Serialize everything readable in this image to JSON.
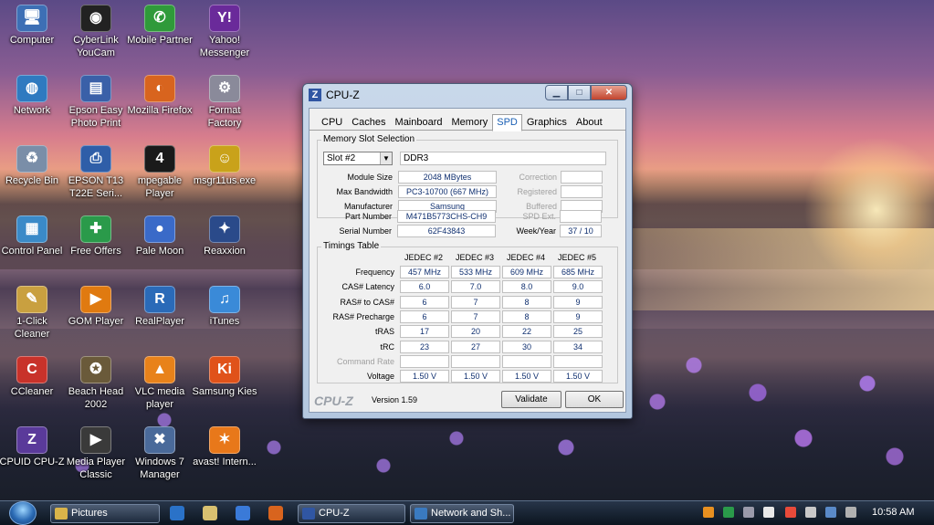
{
  "desktop": {
    "icons": [
      {
        "label": "Computer",
        "glyph": "🖥",
        "color": "#3d6fb5"
      },
      {
        "label": "CyberLink YouCam",
        "glyph": "◉",
        "color": "#222222"
      },
      {
        "label": "Mobile Partner",
        "glyph": "✆",
        "color": "#2f9a3a"
      },
      {
        "label": "Yahoo! Messenger",
        "glyph": "Y!",
        "color": "#6a2a9a"
      },
      {
        "label": "Network",
        "glyph": "◍",
        "color": "#2f7ac0"
      },
      {
        "label": "Epson Easy Photo Print",
        "glyph": "▤",
        "color": "#3a60a8"
      },
      {
        "label": "Mozilla Firefox",
        "glyph": "◐",
        "color": "#d8641e"
      },
      {
        "label": "Format Factory",
        "glyph": "⚙",
        "color": "#8a8a9a"
      },
      {
        "label": "Recycle Bin",
        "glyph": "♻",
        "color": "#7a8ea8"
      },
      {
        "label": "EPSON T13 T22E Seri...",
        "glyph": "⎙",
        "color": "#2f5ea8"
      },
      {
        "label": "mpegable Player",
        "glyph": "4",
        "color": "#1a1a1a"
      },
      {
        "label": "msgr11us.exe",
        "glyph": "☺",
        "color": "#c9a21a"
      },
      {
        "label": "Control Panel",
        "glyph": "▦",
        "color": "#3a8ac8"
      },
      {
        "label": "Free Offers",
        "glyph": "✚",
        "color": "#2a9a4a"
      },
      {
        "label": "Pale Moon",
        "glyph": "●",
        "color": "#3a6ac8"
      },
      {
        "label": "Reaxxion",
        "glyph": "✦",
        "color": "#2a4a8a"
      },
      {
        "label": "1-Click Cleaner",
        "glyph": "✎",
        "color": "#c9a040"
      },
      {
        "label": "GOM Player",
        "glyph": "▶",
        "color": "#e07a10"
      },
      {
        "label": "RealPlayer",
        "glyph": "R",
        "color": "#2a6ab8"
      },
      {
        "label": "iTunes",
        "glyph": "♫",
        "color": "#3a8ad8"
      },
      {
        "label": "CCleaner",
        "glyph": "C",
        "color": "#c8322a"
      },
      {
        "label": "Beach Head 2002",
        "glyph": "✪",
        "color": "#6a5a3a"
      },
      {
        "label": "VLC media player",
        "glyph": "▲",
        "color": "#e8821a"
      },
      {
        "label": "Samsung Kies",
        "glyph": "Ki",
        "color": "#e0521a"
      },
      {
        "label": "CPUID CPU-Z",
        "glyph": "Z",
        "color": "#5a3a9a"
      },
      {
        "label": "Media Player Classic",
        "glyph": "▶",
        "color": "#3a3a3a"
      },
      {
        "label": "Windows 7 Manager",
        "glyph": "✖",
        "color": "#4a6a9a"
      },
      {
        "label": "avast! Intern...",
        "glyph": "✶",
        "color": "#e8781a"
      }
    ]
  },
  "window": {
    "title": "CPU-Z",
    "tabs": [
      "CPU",
      "Caches",
      "Mainboard",
      "Memory",
      "SPD",
      "Graphics",
      "About"
    ],
    "active_tab": "SPD",
    "slot_group_label": "Memory Slot Selection",
    "slot_selected": "Slot #2",
    "memory_type": "DDR3",
    "module": {
      "module_size_label": "Module Size",
      "module_size": "2048 MBytes",
      "max_bandwidth_label": "Max Bandwidth",
      "max_bandwidth": "PC3-10700 (667 MHz)",
      "manufacturer_label": "Manufacturer",
      "manufacturer": "Samsung",
      "part_number_label": "Part Number",
      "part_number": "M471B5773CHS-CH9",
      "serial_number_label": "Serial Number",
      "serial_number": "62F43843",
      "correction_label": "Correction",
      "registered_label": "Registered",
      "buffered_label": "Buffered",
      "spd_ext_label": "SPD Ext.",
      "week_year_label": "Week/Year",
      "week_year": "37 / 10"
    },
    "timings_group_label": "Timings Table",
    "timing_columns": [
      "JEDEC #2",
      "JEDEC #3",
      "JEDEC #4",
      "JEDEC #5"
    ],
    "timing_rows": [
      {
        "label": "Frequency",
        "values": [
          "457 MHz",
          "533 MHz",
          "609 MHz",
          "685 MHz"
        ]
      },
      {
        "label": "CAS# Latency",
        "values": [
          "6.0",
          "7.0",
          "8.0",
          "9.0"
        ]
      },
      {
        "label": "RAS# to CAS#",
        "values": [
          "6",
          "7",
          "8",
          "9"
        ]
      },
      {
        "label": "RAS# Precharge",
        "values": [
          "6",
          "7",
          "8",
          "9"
        ]
      },
      {
        "label": "tRAS",
        "values": [
          "17",
          "20",
          "22",
          "25"
        ]
      },
      {
        "label": "tRC",
        "values": [
          "23",
          "27",
          "30",
          "34"
        ]
      },
      {
        "label": "Command Rate",
        "values": [
          "",
          "",
          "",
          ""
        ]
      },
      {
        "label": "Voltage",
        "values": [
          "1.50 V",
          "1.50 V",
          "1.50 V",
          "1.50 V"
        ]
      }
    ],
    "brand": "CPU-Z",
    "version": "Version 1.59",
    "validate_label": "Validate",
    "ok_label": "OK"
  },
  "taskbar": {
    "items": [
      {
        "label": "Pictures",
        "color": "#d9b44a"
      },
      {
        "label": "CPU-Z",
        "color": "#3056a3"
      },
      {
        "label": "Network and Sh...",
        "color": "#3a7ac0"
      }
    ],
    "clock": "10:58 AM"
  }
}
